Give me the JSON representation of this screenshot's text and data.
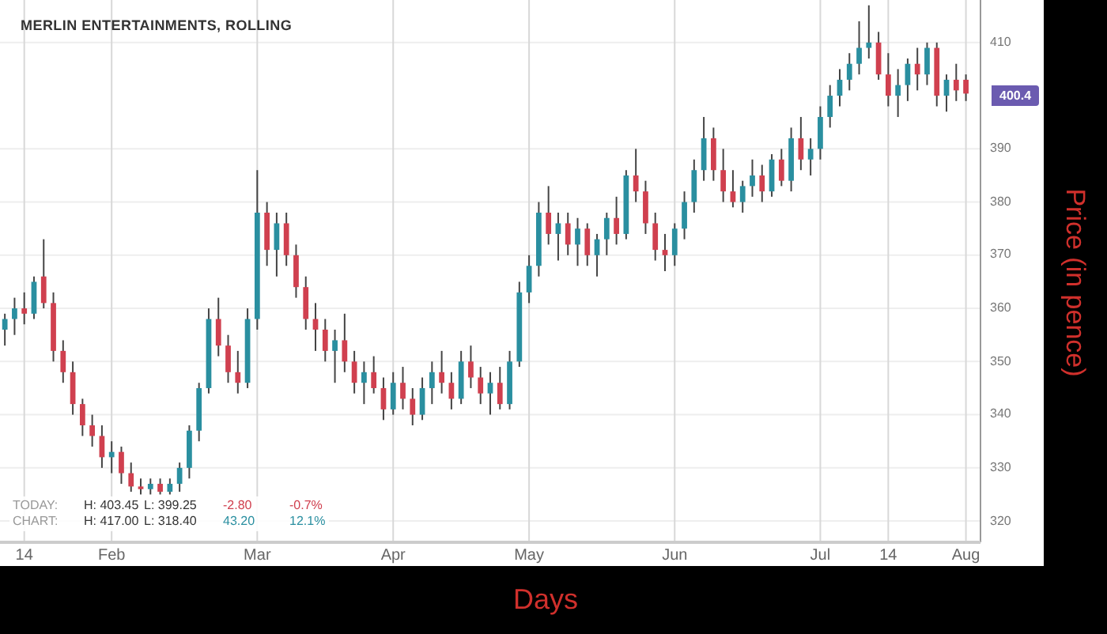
{
  "chart": {
    "stats": [
      {
        "label": "TODAY:",
        "high": "H: 403.45",
        "low": "L: 399.25",
        "change": "-2.80",
        "percent": "-0.7%",
        "color": "#d0404f"
      },
      {
        "label": "CHART:",
        "high": "H: 417.00",
        "low": "L: 318.40",
        "change": "43.20",
        "percent": "12.1%",
        "color": "#2a8fa0"
      }
    ],
    "last_price": "400.4",
    "chart_data": {
      "type": "candlestick",
      "title": "MERLIN ENTERTAINMENTS, ROLLING",
      "xlabel": "Days",
      "ylabel": "Price (in pence)",
      "grid": true,
      "ylim": [
        316,
        418
      ],
      "yticks": [
        320,
        330,
        340,
        350,
        360,
        370,
        380,
        390,
        410
      ],
      "categories": [
        null,
        null,
        "14",
        null,
        null,
        null,
        null,
        null,
        null,
        null,
        null,
        "Feb",
        null,
        null,
        null,
        null,
        null,
        null,
        null,
        null,
        null,
        null,
        null,
        null,
        null,
        null,
        "Mar",
        null,
        null,
        null,
        null,
        null,
        null,
        null,
        null,
        null,
        null,
        null,
        null,
        null,
        "Apr",
        null,
        null,
        null,
        null,
        null,
        null,
        null,
        null,
        null,
        null,
        null,
        null,
        null,
        "May",
        null,
        null,
        null,
        null,
        null,
        null,
        null,
        null,
        null,
        null,
        null,
        null,
        null,
        null,
        "Jun",
        null,
        null,
        null,
        null,
        null,
        null,
        null,
        null,
        null,
        null,
        null,
        null,
        null,
        null,
        "Jul",
        null,
        null,
        null,
        null,
        null,
        null,
        "14",
        null,
        null,
        null,
        null,
        null,
        null,
        null,
        "Aug"
      ],
      "ohlc": [
        [
          356,
          359,
          353,
          358
        ],
        [
          358,
          362,
          355,
          360
        ],
        [
          360,
          363,
          357,
          359
        ],
        [
          359,
          366,
          358,
          365
        ],
        [
          366,
          373,
          360,
          361
        ],
        [
          361,
          363,
          350,
          352
        ],
        [
          352,
          354,
          346,
          348
        ],
        [
          348,
          350,
          340,
          342
        ],
        [
          342,
          343,
          336,
          338
        ],
        [
          338,
          340,
          334,
          336
        ],
        [
          336,
          338,
          330,
          332
        ],
        [
          332,
          335,
          329,
          333
        ],
        [
          333,
          334,
          327,
          329
        ],
        [
          329,
          331,
          325.5,
          326.5
        ],
        [
          326.5,
          328,
          325,
          326
        ],
        [
          326,
          328,
          325,
          327
        ],
        [
          327,
          328,
          325,
          325.5
        ],
        [
          325.5,
          328,
          325,
          327
        ],
        [
          327,
          331,
          325.5,
          330
        ],
        [
          330,
          338,
          328,
          337
        ],
        [
          337,
          346,
          335,
          345
        ],
        [
          345,
          360,
          344,
          358
        ],
        [
          358,
          362,
          351,
          353
        ],
        [
          353,
          355,
          346,
          348
        ],
        [
          348,
          352,
          344,
          346
        ],
        [
          346,
          360,
          345,
          358
        ],
        [
          358,
          386,
          356,
          378
        ],
        [
          378,
          380,
          368,
          371
        ],
        [
          371,
          378,
          366,
          376
        ],
        [
          376,
          378,
          368,
          370
        ],
        [
          370,
          372,
          362,
          364
        ],
        [
          364,
          366,
          356,
          358
        ],
        [
          358,
          361,
          352,
          356
        ],
        [
          356,
          358,
          350,
          352
        ],
        [
          352,
          356,
          346,
          354
        ],
        [
          354,
          359,
          348,
          350
        ],
        [
          350,
          352,
          344,
          346
        ],
        [
          346,
          350,
          342,
          348
        ],
        [
          348,
          351,
          344,
          345
        ],
        [
          345,
          347,
          339,
          341
        ],
        [
          341,
          348,
          340,
          346
        ],
        [
          346,
          349,
          341,
          343
        ],
        [
          343,
          345,
          338,
          340
        ],
        [
          340,
          347,
          339,
          345
        ],
        [
          345,
          350,
          342,
          348
        ],
        [
          348,
          352,
          344,
          346
        ],
        [
          346,
          348,
          341,
          343
        ],
        [
          343,
          352,
          342,
          350
        ],
        [
          350,
          353,
          345,
          347
        ],
        [
          347,
          349,
          342,
          344
        ],
        [
          344,
          348,
          340,
          346
        ],
        [
          346,
          349,
          341,
          342
        ],
        [
          342,
          352,
          341,
          350
        ],
        [
          350,
          365,
          349,
          363
        ],
        [
          363,
          370,
          361,
          368
        ],
        [
          368,
          380,
          366,
          378
        ],
        [
          378,
          383,
          372,
          374
        ],
        [
          374,
          378,
          369,
          376
        ],
        [
          376,
          378,
          370,
          372
        ],
        [
          372,
          377,
          368,
          375
        ],
        [
          375,
          376,
          368,
          370
        ],
        [
          370,
          374,
          366,
          373
        ],
        [
          373,
          378,
          370,
          377
        ],
        [
          377,
          381,
          372,
          374
        ],
        [
          374,
          386,
          373,
          385
        ],
        [
          385,
          390,
          380,
          382
        ],
        [
          382,
          384,
          374,
          376
        ],
        [
          376,
          378,
          369,
          371
        ],
        [
          371,
          374,
          367,
          370
        ],
        [
          370,
          376,
          368,
          375
        ],
        [
          375,
          382,
          373,
          380
        ],
        [
          380,
          388,
          378,
          386
        ],
        [
          386,
          396,
          384,
          392
        ],
        [
          392,
          394,
          384,
          386
        ],
        [
          386,
          390,
          380,
          382
        ],
        [
          382,
          386,
          379,
          380
        ],
        [
          380,
          384,
          378,
          383
        ],
        [
          383,
          388,
          381,
          385
        ],
        [
          385,
          387,
          380,
          382
        ],
        [
          382,
          389,
          381,
          388
        ],
        [
          388,
          390,
          383,
          384
        ],
        [
          384,
          394,
          382,
          392
        ],
        [
          392,
          396,
          386,
          388
        ],
        [
          388,
          392,
          385,
          390
        ],
        [
          390,
          398,
          388,
          396
        ],
        [
          396,
          402,
          394,
          400
        ],
        [
          400,
          405,
          398,
          403
        ],
        [
          403,
          408,
          401,
          406
        ],
        [
          406,
          414,
          404,
          409
        ],
        [
          409,
          417,
          407,
          410
        ],
        [
          410,
          412,
          403,
          404
        ],
        [
          404,
          408,
          398,
          400
        ],
        [
          400,
          405,
          396,
          402
        ],
        [
          402,
          407,
          399,
          406
        ],
        [
          406,
          409,
          401,
          404
        ],
        [
          404,
          410,
          402,
          409
        ],
        [
          409,
          410,
          398,
          400
        ],
        [
          400,
          404,
          397,
          403
        ],
        [
          403,
          406,
          399,
          401
        ],
        [
          403,
          404,
          399,
          400.4
        ]
      ]
    }
  }
}
